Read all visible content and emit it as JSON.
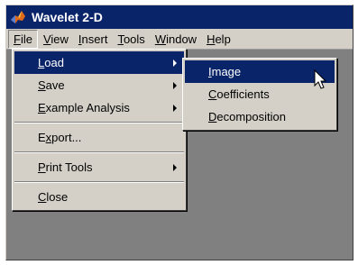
{
  "window": {
    "title": "Wavelet 2-D"
  },
  "menubar": {
    "items": [
      {
        "label": "File",
        "ul": "F",
        "rest": "ile"
      },
      {
        "label": "View",
        "ul": "V",
        "rest": "iew"
      },
      {
        "label": "Insert",
        "ul": "I",
        "rest": "nsert"
      },
      {
        "label": "Tools",
        "ul": "T",
        "rest": "ools"
      },
      {
        "label": "Window",
        "ul": "W",
        "rest": "indow"
      },
      {
        "label": "Help",
        "ul": "H",
        "rest": "elp"
      }
    ]
  },
  "file_menu": {
    "items": [
      {
        "label": "Load",
        "ul": "L",
        "rest": "oad",
        "has_submenu": true,
        "highlighted": true
      },
      {
        "label": "Save",
        "ul": "S",
        "rest": "ave",
        "has_submenu": true
      },
      {
        "label": "Example Analysis",
        "ul": "E",
        "rest": "xample Analysis",
        "has_submenu": true
      },
      {
        "label": "Export...",
        "pre": "E",
        "ul": "x",
        "rest": "port..."
      },
      {
        "label": "Print Tools",
        "ul": "P",
        "rest": "rint Tools",
        "has_submenu": true
      },
      {
        "label": "Close",
        "ul": "C",
        "rest": "lose"
      }
    ]
  },
  "load_submenu": {
    "items": [
      {
        "label": "Image",
        "ul": "I",
        "rest": "mage",
        "highlighted": true
      },
      {
        "label": "Coefficients",
        "ul": "C",
        "rest": "oefficients"
      },
      {
        "label": "Decomposition",
        "ul": "D",
        "rest": "ecomposition"
      }
    ]
  },
  "icons": {
    "app": "matlab-logo-icon",
    "cursor": "mouse-pointer-icon",
    "submenu_arrow": "triangle-right-icon"
  },
  "colors": {
    "titlebar": "#0a246a",
    "highlight": "#0a246a",
    "menu_bg": "#d4d0c8",
    "client_bg": "#808080"
  }
}
